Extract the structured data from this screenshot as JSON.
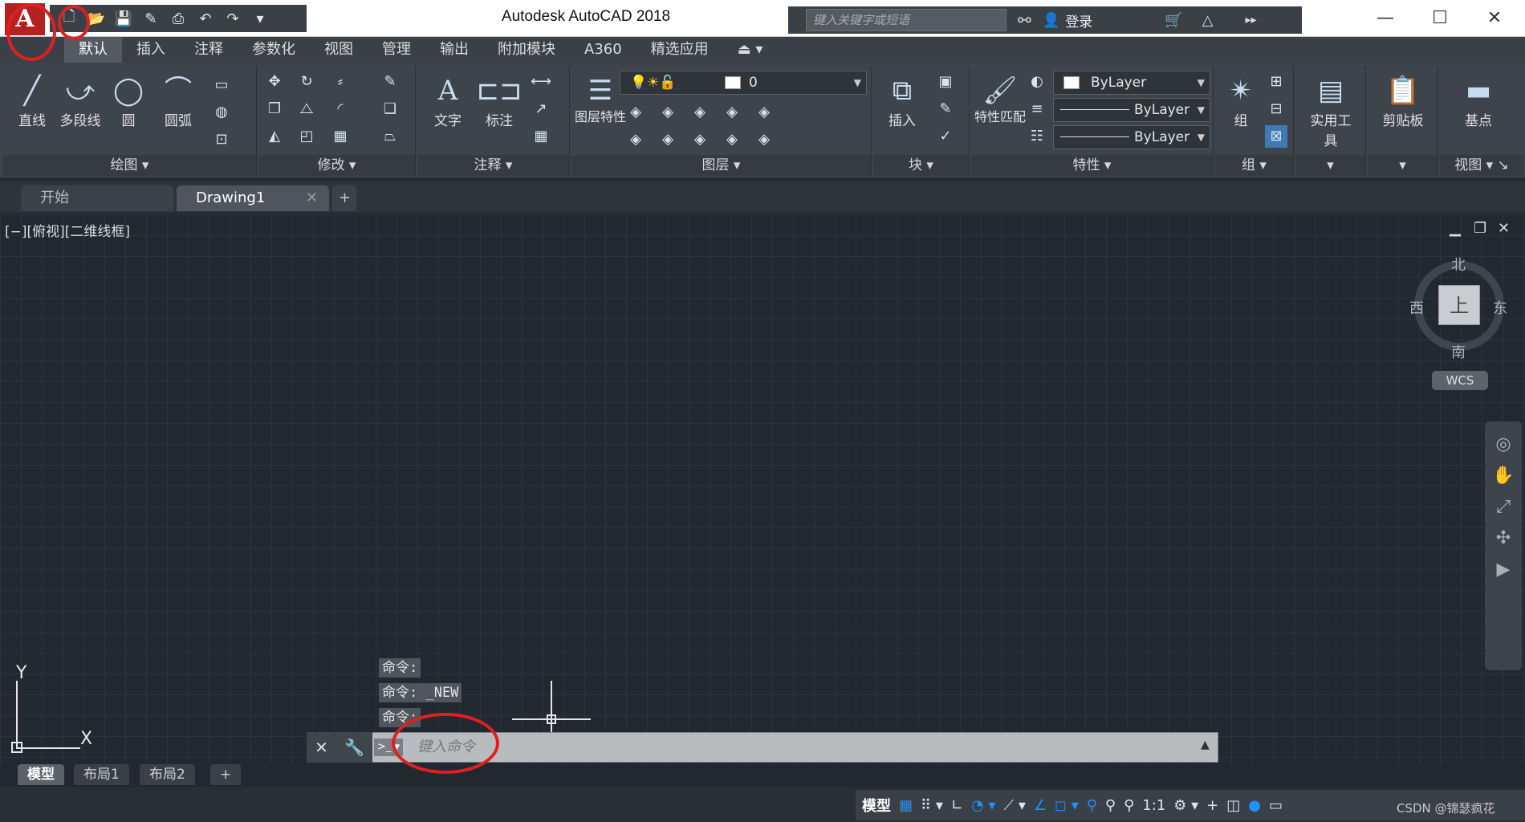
{
  "window": {
    "title": "Autodesk AutoCAD 2018"
  },
  "app_button": {
    "label": "A"
  },
  "quick_access": [
    "new-icon",
    "open-icon",
    "save-icon",
    "saveas-icon",
    "print-icon",
    "undo-icon",
    "redo-icon",
    "customize-icon"
  ],
  "search": {
    "placeholder": "键入关键字或短语"
  },
  "login": {
    "label": "登录"
  },
  "menu_tabs": [
    "默认",
    "插入",
    "注释",
    "参数化",
    "视图",
    "管理",
    "输出",
    "附加模块",
    "A360",
    "精选应用"
  ],
  "ribbon": {
    "draw": {
      "title": "绘图",
      "tools": [
        "直线",
        "多段线",
        "圆",
        "圆弧"
      ]
    },
    "modify": {
      "title": "修改"
    },
    "annotation": {
      "title": "注释",
      "tools": [
        "文字",
        "标注"
      ]
    },
    "layers": {
      "title": "图层",
      "tools": [
        "图层特性"
      ],
      "current_layer": "0"
    },
    "block": {
      "title": "块",
      "tools": [
        "插入"
      ]
    },
    "properties": {
      "title": "特性",
      "match_label": "特性匹配",
      "color": "ByLayer",
      "linetype": "ByLayer",
      "lineweight": "ByLayer"
    },
    "groups": {
      "title": "组",
      "tools": [
        "组"
      ]
    },
    "utilities": {
      "label": "实用工具"
    },
    "clipboard": {
      "label": "剪贴板"
    },
    "view": {
      "title": "视图",
      "tools": [
        "基点"
      ]
    }
  },
  "doc_tabs": {
    "start": "开始",
    "drawing": "Drawing1"
  },
  "viewport": {
    "label": "[−][俯视][二维线框]"
  },
  "viewcube": {
    "face": "上",
    "north": "北",
    "south": "南",
    "east": "东",
    "west": "西",
    "wcs": "WCS"
  },
  "ucs": {
    "x": "X",
    "y": "Y"
  },
  "command_history": [
    "命令:",
    "命令: _NEW",
    "命令:"
  ],
  "command_line": {
    "placeholder": "键入命令"
  },
  "layout_tabs": [
    "模型",
    "布局1",
    "布局2"
  ],
  "status_bar": {
    "model": "模型",
    "scale": "1:1"
  },
  "watermark": "CSDN @锦瑟疯花",
  "colors": {
    "accent_red": "#e02020",
    "app_button": "#b32121",
    "viewport_bg": "#212830"
  }
}
